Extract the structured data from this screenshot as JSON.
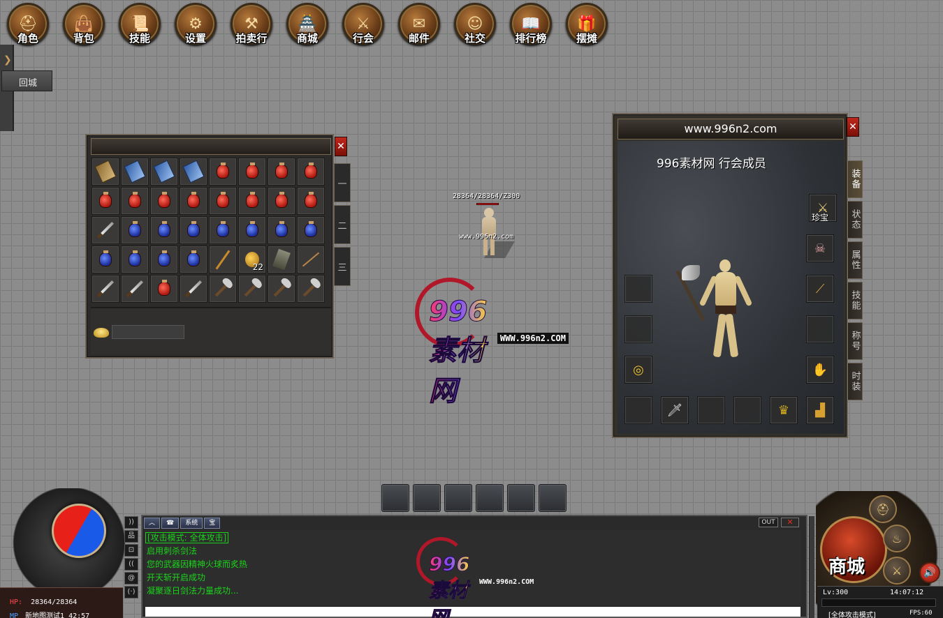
{
  "top_menu": [
    {
      "label": "角色",
      "icon": "helmet-icon"
    },
    {
      "label": "背包",
      "icon": "bag-icon"
    },
    {
      "label": "技能",
      "icon": "scroll-icon"
    },
    {
      "label": "设置",
      "icon": "gear-icon"
    },
    {
      "label": "拍卖行",
      "icon": "gavel-icon"
    },
    {
      "label": "商城",
      "icon": "shop-icon"
    },
    {
      "label": "行会",
      "icon": "crossed-swords-icon"
    },
    {
      "label": "邮件",
      "icon": "mail-icon"
    },
    {
      "label": "社交",
      "icon": "people-icon"
    },
    {
      "label": "排行榜",
      "icon": "book-icon"
    },
    {
      "label": "摆摊",
      "icon": "treasure-chest-icon"
    }
  ],
  "return_button": "回城",
  "bag": {
    "tabs": [
      "一",
      "二",
      "三"
    ],
    "close": "✕",
    "gold_value": "",
    "slots": [
      {
        "item": "book-brown"
      },
      {
        "item": "book"
      },
      {
        "item": "book"
      },
      {
        "item": "book"
      },
      {
        "item": "potion-red"
      },
      {
        "item": "potion-red"
      },
      {
        "item": "potion-red"
      },
      {
        "item": "potion-red"
      },
      {
        "item": "potion-red"
      },
      {
        "item": "potion-red"
      },
      {
        "item": "potion-red"
      },
      {
        "item": "potion-red"
      },
      {
        "item": "potion-red"
      },
      {
        "item": "potion-red"
      },
      {
        "item": "potion-red"
      },
      {
        "item": "potion-red"
      },
      {
        "item": "sword"
      },
      {
        "item": "potion-blue"
      },
      {
        "item": "potion-blue"
      },
      {
        "item": "potion-blue"
      },
      {
        "item": "potion-blue"
      },
      {
        "item": "potion-blue"
      },
      {
        "item": "potion-blue"
      },
      {
        "item": "potion-blue"
      },
      {
        "item": "potion-blue"
      },
      {
        "item": "potion-blue"
      },
      {
        "item": "potion-blue"
      },
      {
        "item": "potion-blue"
      },
      {
        "item": "staff"
      },
      {
        "item": "gourd",
        "count": "22"
      },
      {
        "item": "scroll"
      },
      {
        "item": "rod"
      },
      {
        "item": "sword"
      },
      {
        "item": "sword"
      },
      {
        "item": "potion-red"
      },
      {
        "item": "sword"
      },
      {
        "item": "axe"
      },
      {
        "item": "axe"
      },
      {
        "item": "axe"
      },
      {
        "item": "axe"
      }
    ]
  },
  "player": {
    "hp_text": "28364/28364/Z300",
    "name": "www.996n2.com",
    "hp_fraction": 1.0
  },
  "watermark": {
    "brand": "996素材网",
    "url": "WWW.996n2.COM"
  },
  "equip": {
    "title": "www.996n2.com",
    "guild_line": "996素材网 行会成员",
    "treasure_label": "珍宝",
    "close": "✕",
    "side_tabs": [
      "装备",
      "状态",
      "属性",
      "技能",
      "称号",
      "时装"
    ]
  },
  "chat": {
    "tabs": [
      "︿",
      "☎",
      "系统",
      "宝"
    ],
    "out_label": "OUT",
    "close": "✕",
    "lines": [
      "[攻击模式: 全体攻击]",
      "启用刺杀剑法",
      "您的武器因精神火球而炙热",
      "开天斩开启成功",
      "凝聚逐日剑法力量成功..."
    ],
    "icons": [
      "))",
      "品",
      "⊡",
      "((",
      "@",
      "(·)"
    ]
  },
  "status": {
    "hp_label": "HP:",
    "hp_value": "28364/28364",
    "mp_label": "MP",
    "mp_value": "新地图测试1 42:57"
  },
  "shop": {
    "label": "商城"
  },
  "info": {
    "level": "Lv:300",
    "time": "14:07:12",
    "mode": "[全体攻击模式]",
    "fps": "FPS:60"
  }
}
